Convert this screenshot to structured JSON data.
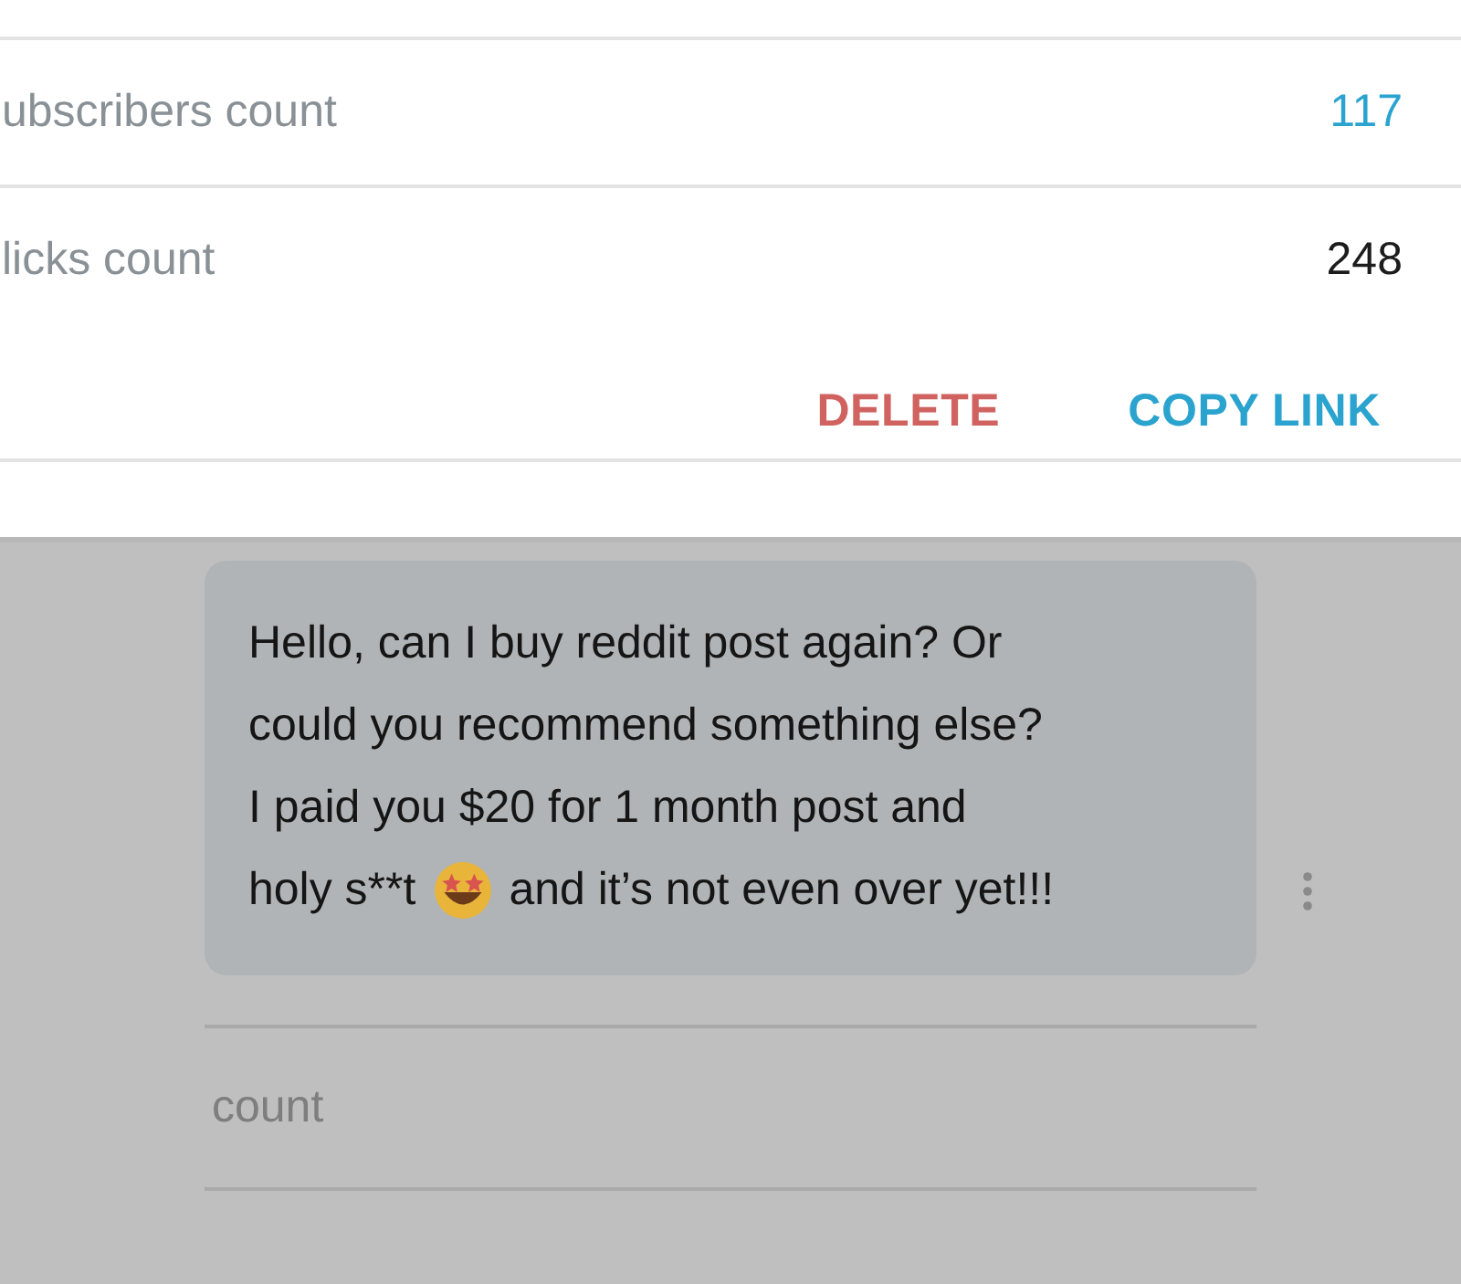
{
  "stats": [
    {
      "label": "ubscribers count",
      "value": "117",
      "kind": "link"
    },
    {
      "label": "licks count",
      "value": "248",
      "kind": "plain"
    }
  ],
  "actions": [
    {
      "label": "DELETE",
      "kind": "danger"
    },
    {
      "label": "COPY LINK",
      "kind": "primary"
    }
  ],
  "message": {
    "lines": [
      "Hello, can I buy reddit post again? Or",
      "could you recommend something else?",
      "I paid you $20 for 1 month post and"
    ],
    "last_before": "holy s**t",
    "last_after": "and it’s not even over yet!!!"
  },
  "background_field": {
    "label": "count"
  }
}
